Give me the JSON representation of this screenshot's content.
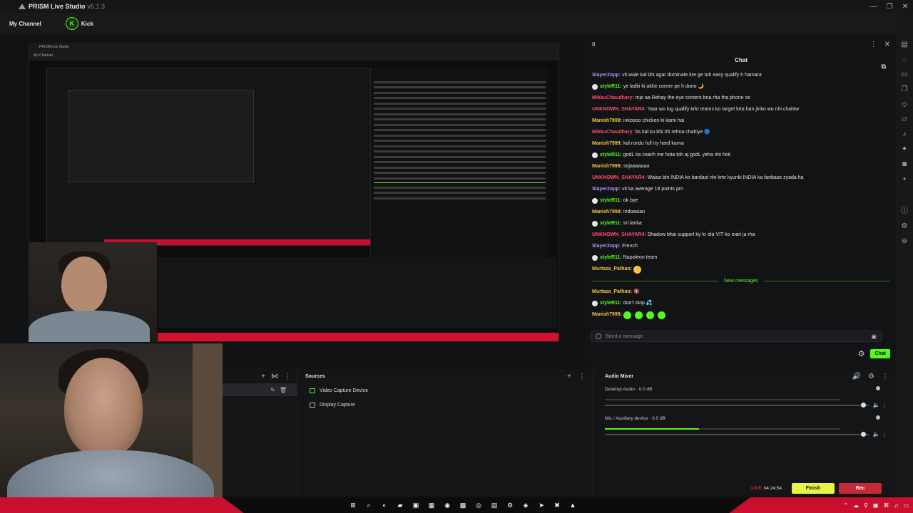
{
  "app": {
    "title": "PRISM Live Studio",
    "version": "v5.1.3",
    "window_controls": [
      "—",
      "❐",
      "✕"
    ]
  },
  "channel_bar": {
    "my_channel": "My Channel",
    "platform": "Kick",
    "platform_initial": "K"
  },
  "preview": {
    "mini_title": "PRISM Live Studio",
    "mini_channel": "My Channel"
  },
  "chat": {
    "panel_number": "8",
    "title": "Chat",
    "new_messages_label": "New messages",
    "input_placeholder": "Send a message",
    "chat_button": "Chat",
    "messages": [
      {
        "user": "Slayer2opp",
        "color": "#b197fc",
        "text": "vit wale kal bhi agar dominate kre ge toh easy qualify h hamara",
        "badge": false
      },
      {
        "user": "styleR11",
        "color": "#53fc18",
        "text": "ye ladki ki akhe corner pe h dono 🌙",
        "badge": true
      },
      {
        "user": "MikkuChaudhary",
        "color": "#ff4d6d",
        "text": "mje aa Rehay the eye content bna rha tha phone se",
        "badge": false
      },
      {
        "user": "UNKNOWN_SHAYAR4",
        "color": "#ff4d6d",
        "text": "Yaar wo log qualify krkr teams ko target krta han jinko wo nhi chahtw",
        "badge": false
      },
      {
        "user": "Manish7999",
        "color": "#f3c43a",
        "text": "inkoooo chicken ki kami hai",
        "badge": false
      },
      {
        "user": "MikkuChaudhary",
        "color": "#ff4d6d",
        "text": "bs kal ko bhi #5 rehna chahiye 🔵",
        "badge": false
      },
      {
        "user": "Manish7999",
        "color": "#f3c43a",
        "text": "kal rondu full try hard karna",
        "badge": false
      },
      {
        "user": "styleR11",
        "color": "#53fc18",
        "text": "godL ka coach me hota toh aj godL yaha nhi hoti",
        "badge": true
      },
      {
        "user": "Manish7999",
        "color": "#f3c43a",
        "text": "sojaaaaaaa",
        "badge": false
      },
      {
        "user": "UNKNOWN_SHAYAR4",
        "color": "#ff4d6d",
        "text": "Waisa bhi INDIA ko bardast nhi krte kyunki INDIA ka fanbase zyada ha",
        "badge": false
      },
      {
        "user": "Slayer2opp",
        "color": "#b197fc",
        "text": "vit ka average 18 points pm",
        "badge": false
      },
      {
        "user": "styleR11",
        "color": "#53fc18",
        "text": "ok bye",
        "badge": true
      },
      {
        "user": "Manish7999",
        "color": "#f3c43a",
        "text": "indoasian",
        "badge": false
      },
      {
        "user": "styleR11",
        "color": "#53fc18",
        "text": "sri lanka",
        "badge": true
      },
      {
        "user": "UNKNOWN_SHAYAR4",
        "color": "#ff4d6d",
        "text": "Shadow bhai support ky kr dia VIT ko mari ja rha",
        "badge": false
      },
      {
        "user": "Slayer2opp",
        "color": "#b197fc",
        "text": "French",
        "badge": false
      },
      {
        "user": "styleR11",
        "color": "#53fc18",
        "text": "Napoleon team",
        "badge": true
      },
      {
        "user": "Murtaza_Pathan",
        "color": "#f3c43a",
        "text": "",
        "badge": false,
        "emotes": 1,
        "emote_color": "yellow"
      }
    ],
    "after_new": [
      {
        "user": "Murtaza_Pathan",
        "color": "#f3c43a",
        "text": "🔇",
        "badge": false
      },
      {
        "user": "styleR11",
        "color": "#53fc18",
        "text": "don't stop 💦",
        "badge": true
      },
      {
        "user": "Manish7999",
        "color": "#f3c43a",
        "text": "",
        "badge": false,
        "emotes": 4,
        "emote_color": "green"
      }
    ]
  },
  "sources": {
    "title": "Sources",
    "items": [
      {
        "label": "Video Capture Device",
        "icon": "camera-icon"
      },
      {
        "label": "Display Capture",
        "icon": "monitor-icon"
      }
    ]
  },
  "mixer": {
    "title": "Audio Mixer",
    "channels": [
      {
        "label": "Desktop Audio · 0.0 dB",
        "level": 0.0,
        "fader": 0.98
      },
      {
        "label": "Mic / Auxiliary device · 0.0 dB",
        "level": 0.4,
        "fader": 0.98
      }
    ]
  },
  "status": {
    "live_label": "LIVE",
    "time": "04:24:54",
    "finish": "Finish",
    "rec": "Rec"
  },
  "colors": {
    "accent": "#53fc18",
    "finish": "#e8f544",
    "rec": "#c42a36",
    "taskbar": "#c8102e"
  }
}
